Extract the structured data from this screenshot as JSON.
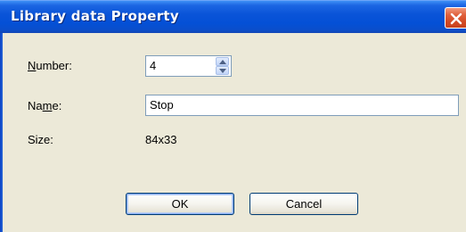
{
  "window": {
    "title": "Library data Property",
    "close_icon": "close-icon"
  },
  "form": {
    "number": {
      "label_pre": "",
      "label_accel": "N",
      "label_post": "umber:",
      "value": "4"
    },
    "name": {
      "label_pre": "Na",
      "label_accel": "m",
      "label_post": "e:",
      "value": "Stop"
    },
    "size": {
      "label": "Size:",
      "value": "84x33"
    }
  },
  "buttons": {
    "ok_label": "OK",
    "cancel_label": "Cancel"
  },
  "colors": {
    "titlebar": "#0450d6",
    "dialog_bg": "#ece9d8",
    "close_button": "#d34a24"
  }
}
